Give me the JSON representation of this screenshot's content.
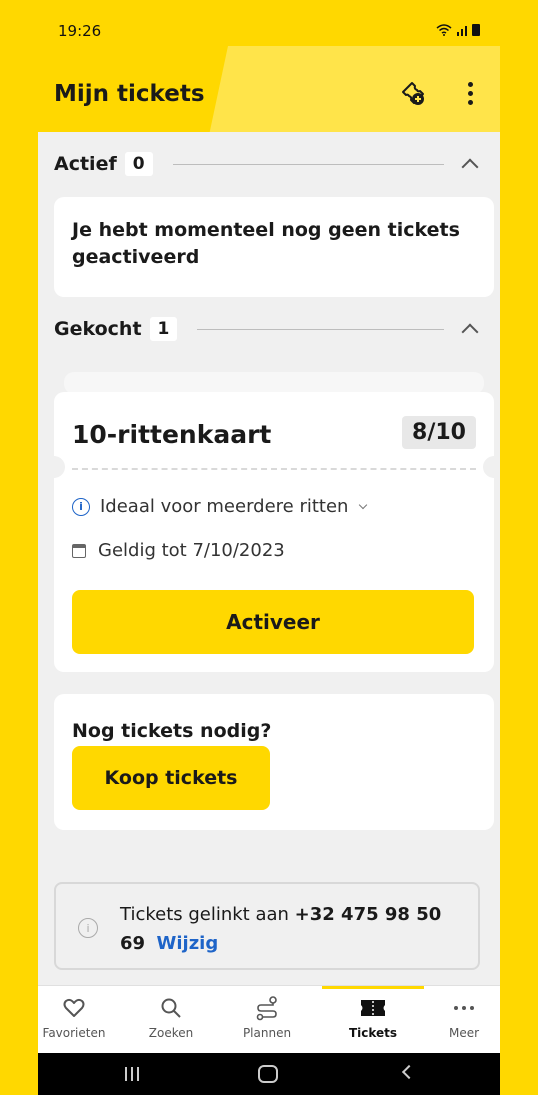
{
  "status": {
    "time": "19:26"
  },
  "header": {
    "title": "Mijn tickets",
    "add_icon": "ticket-add-icon",
    "more_icon": "more-vertical-icon"
  },
  "sections": {
    "active": {
      "label": "Actief",
      "count": "0",
      "empty_text": "Je hebt momenteel nog geen tickets geactiveerd"
    },
    "bought": {
      "label": "Gekocht",
      "count": "1"
    }
  },
  "ticket": {
    "name": "10-rittenkaart",
    "rides": "8/10",
    "info": "Ideaal voor meerdere ritten",
    "valid": "Geldig tot 7/10/2023",
    "activate_label": "Activeer"
  },
  "buy": {
    "question": "Nog tickets nodig?",
    "button": "Koop tickets"
  },
  "link": {
    "prefix": "Tickets gelinkt aan ",
    "phone": "+32 475 98 50 69",
    "edit": "Wijzig"
  },
  "tabs": [
    {
      "label": "Favorieten",
      "icon": "heart-icon"
    },
    {
      "label": "Zoeken",
      "icon": "search-icon"
    },
    {
      "label": "Plannen",
      "icon": "route-icon"
    },
    {
      "label": "Tickets",
      "icon": "ticket-icon",
      "active": true
    },
    {
      "label": "Meer",
      "icon": "more-horizontal-icon"
    }
  ],
  "colors": {
    "brand_yellow": "#FFD800",
    "link_blue": "#1E64C8"
  }
}
